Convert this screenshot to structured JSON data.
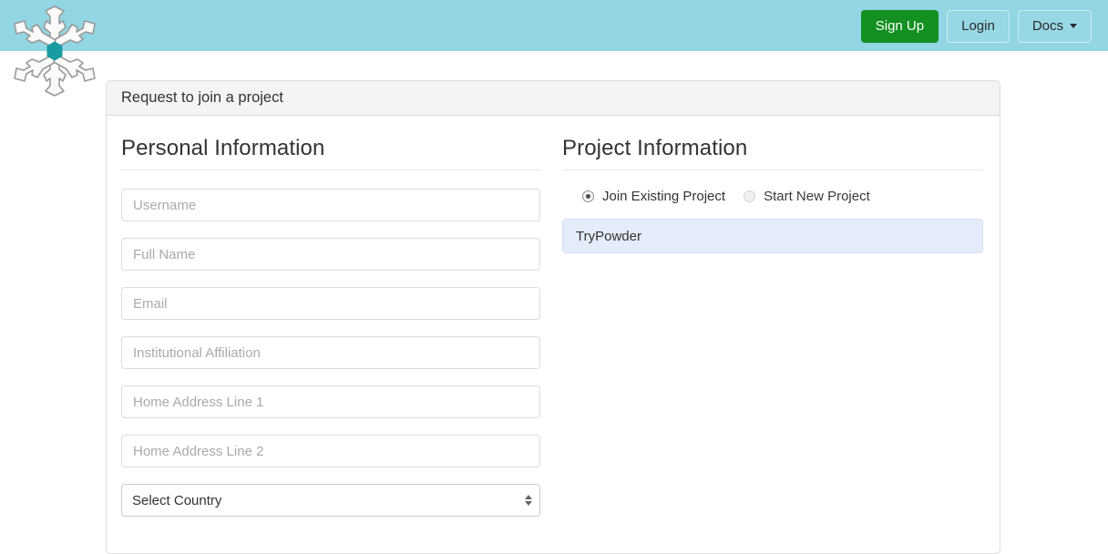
{
  "theme": {
    "navbar_bg": "#92d5e3",
    "signup_green": "#139021",
    "panel_border": "#dddddd",
    "panel_head_bg": "#f4f4f4",
    "selected_item_bg": "#e4ecf9",
    "logo_center": "#1a9ba1"
  },
  "navbar": {
    "logo_name": "snowflake-logo",
    "buttons": [
      {
        "label": "Sign Up",
        "style": "primary"
      },
      {
        "label": "Login",
        "style": "ghost"
      },
      {
        "label": "Docs",
        "style": "ghost",
        "caret": true
      }
    ]
  },
  "panel": {
    "title": "Request to join a project"
  },
  "personal": {
    "heading": "Personal Information",
    "fields": [
      {
        "name": "username",
        "placeholder": "Username",
        "value": ""
      },
      {
        "name": "full-name",
        "placeholder": "Full Name",
        "value": ""
      },
      {
        "name": "email",
        "placeholder": "Email",
        "value": ""
      },
      {
        "name": "institutional-affiliation",
        "placeholder": "Institutional Affiliation",
        "value": ""
      },
      {
        "name": "home-address-line-1",
        "placeholder": "Home Address Line 1",
        "value": ""
      },
      {
        "name": "home-address-line-2",
        "placeholder": "Home Address Line 2",
        "value": ""
      }
    ],
    "country_select": {
      "name": "country",
      "selected": "Select Country"
    }
  },
  "project": {
    "heading": "Project Information",
    "options": [
      {
        "label": "Join Existing Project",
        "checked": true
      },
      {
        "label": "Start New Project",
        "checked": false
      }
    ],
    "list": [
      {
        "label": "TryPowder",
        "selected": true
      }
    ]
  }
}
